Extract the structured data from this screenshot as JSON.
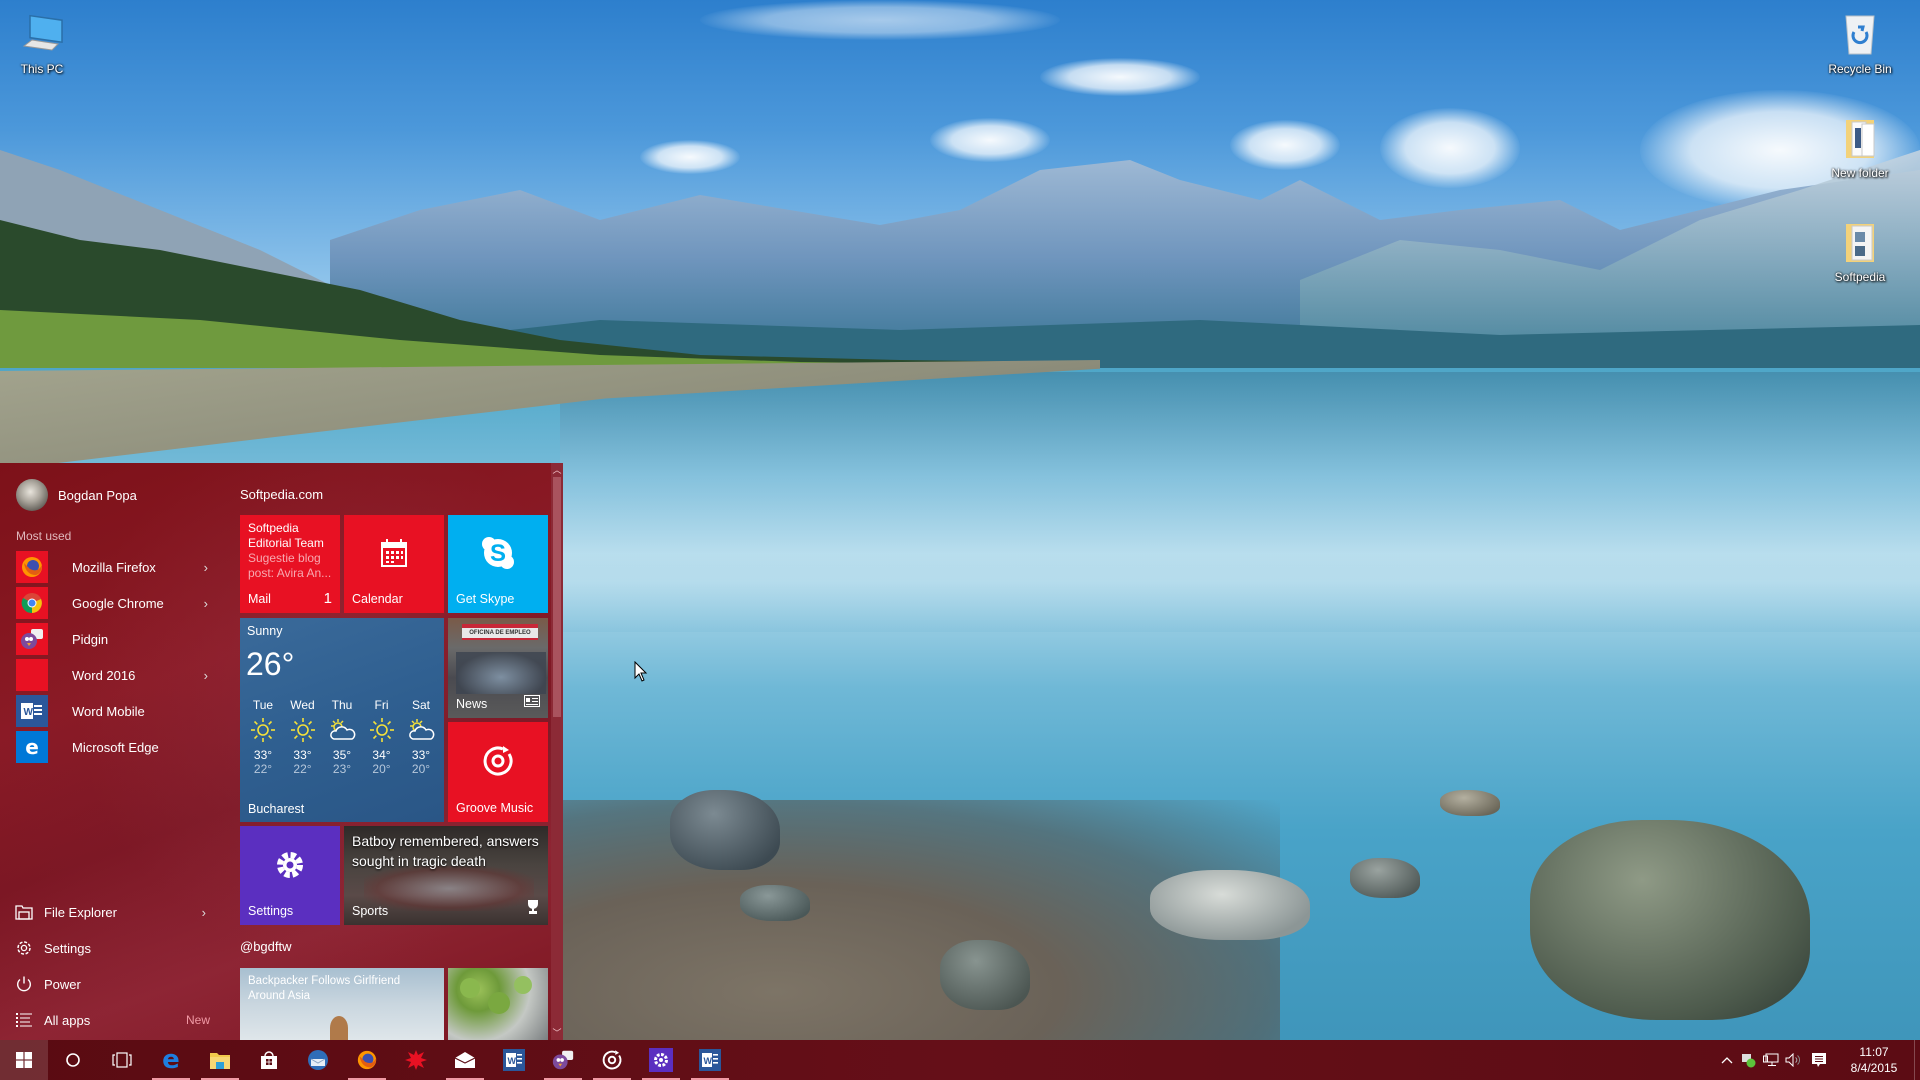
{
  "desktop": {
    "icons": [
      {
        "label": "This PC",
        "icon": "computer-icon"
      },
      {
        "label": "Recycle Bin",
        "icon": "recycle-bin-icon"
      },
      {
        "label": "New folder",
        "icon": "folder-icon"
      },
      {
        "label": "Softpedia",
        "icon": "folder-icon"
      }
    ]
  },
  "start_menu": {
    "user": {
      "name": "Bogdan Popa"
    },
    "most_used_label": "Most used",
    "apps": [
      {
        "label": "Mozilla Firefox",
        "icon": "firefox-icon",
        "has_submenu": true,
        "tile_color": "#e81123"
      },
      {
        "label": "Google Chrome",
        "icon": "chrome-icon",
        "has_submenu": true,
        "tile_color": "#e81123"
      },
      {
        "label": "Pidgin",
        "icon": "pidgin-icon",
        "has_submenu": false,
        "tile_color": "#e81123"
      },
      {
        "label": "Word 2016",
        "icon": "word-2016-icon",
        "has_submenu": true,
        "tile_color": "#e81123"
      },
      {
        "label": "Word Mobile",
        "icon": "word-mobile-icon",
        "has_submenu": false,
        "tile_color": "#2b579a"
      },
      {
        "label": "Microsoft Edge",
        "icon": "edge-icon",
        "has_submenu": false,
        "tile_color": "#0078d7"
      }
    ],
    "bottom": [
      {
        "label": "File Explorer",
        "icon": "file-explorer-icon",
        "has_submenu": true
      },
      {
        "label": "Settings",
        "icon": "gear-icon"
      },
      {
        "label": "Power",
        "icon": "power-icon"
      },
      {
        "label": "All apps",
        "icon": "all-apps-icon",
        "badge": "New"
      }
    ],
    "tile_groups": [
      {
        "title": "Softpedia.com"
      },
      {
        "title": "@bgdftw"
      }
    ],
    "tiles": {
      "mail": {
        "sender": "Softpedia Editorial Team",
        "preview": "Sugestie blog post: Avira An...",
        "label": "Mail",
        "count": "1",
        "color": "#e81123"
      },
      "calendar": {
        "label": "Calendar",
        "color": "#e81123"
      },
      "skype": {
        "label": "Get Skype",
        "color": "#00aff0"
      },
      "weather": {
        "condition": "Sunny",
        "temperature": "26°",
        "city": "Bucharest",
        "forecast": [
          {
            "day": "Tue",
            "icon": "sunny",
            "high": "33°",
            "low": "22°"
          },
          {
            "day": "Wed",
            "icon": "sunny",
            "high": "33°",
            "low": "22°"
          },
          {
            "day": "Thu",
            "icon": "partly-cloudy",
            "high": "35°",
            "low": "23°"
          },
          {
            "day": "Fri",
            "icon": "sunny",
            "high": "34°",
            "low": "20°"
          },
          {
            "day": "Sat",
            "icon": "partly-cloudy",
            "high": "33°",
            "low": "20°"
          }
        ]
      },
      "news": {
        "label": "News",
        "sign_text": "OFICINA DE EMPLEO"
      },
      "groove": {
        "label": "Groove Music",
        "color": "#e81123"
      },
      "settings": {
        "label": "Settings",
        "color": "#5b2fc0"
      },
      "sports": {
        "headline": "Batboy remembered, answers sought in tragic death",
        "label": "Sports"
      },
      "backpacker": {
        "headline": "Backpacker Follows Girlfriend Around Asia"
      }
    }
  },
  "taskbar": {
    "buttons": [
      {
        "name": "start-button",
        "icon": "windows-logo-icon",
        "active": false
      },
      {
        "name": "cortana-button",
        "icon": "cortana-icon",
        "active": false
      },
      {
        "name": "task-view-button",
        "icon": "task-view-icon",
        "active": false
      },
      {
        "name": "taskbar-edge",
        "icon": "edge-icon",
        "active": true
      },
      {
        "name": "taskbar-file-explorer",
        "icon": "file-explorer-icon",
        "active": true
      },
      {
        "name": "taskbar-store",
        "icon": "store-icon",
        "active": false
      },
      {
        "name": "taskbar-thunderbird",
        "icon": "thunderbird-icon",
        "active": false
      },
      {
        "name": "taskbar-firefox",
        "icon": "firefox-icon",
        "active": true
      },
      {
        "name": "taskbar-red-app",
        "icon": "red-splat-app-icon",
        "active": false
      },
      {
        "name": "taskbar-mail",
        "icon": "mail-icon",
        "active": true
      },
      {
        "name": "taskbar-word-mobile",
        "icon": "word-icon",
        "active": false
      },
      {
        "name": "taskbar-pidgin",
        "icon": "pidgin-icon",
        "active": true
      },
      {
        "name": "taskbar-groove",
        "icon": "groove-music-icon",
        "active": true
      },
      {
        "name": "taskbar-settings",
        "icon": "gear-icon",
        "active": true
      },
      {
        "name": "taskbar-word",
        "icon": "word-icon",
        "active": true
      }
    ],
    "tray": {
      "icons": [
        "show-hidden-icons-chevron",
        "network-status-icon",
        "network-icon",
        "volume-icon",
        "action-center-icon"
      ],
      "time": "11:07",
      "date": "8/4/2015"
    }
  }
}
